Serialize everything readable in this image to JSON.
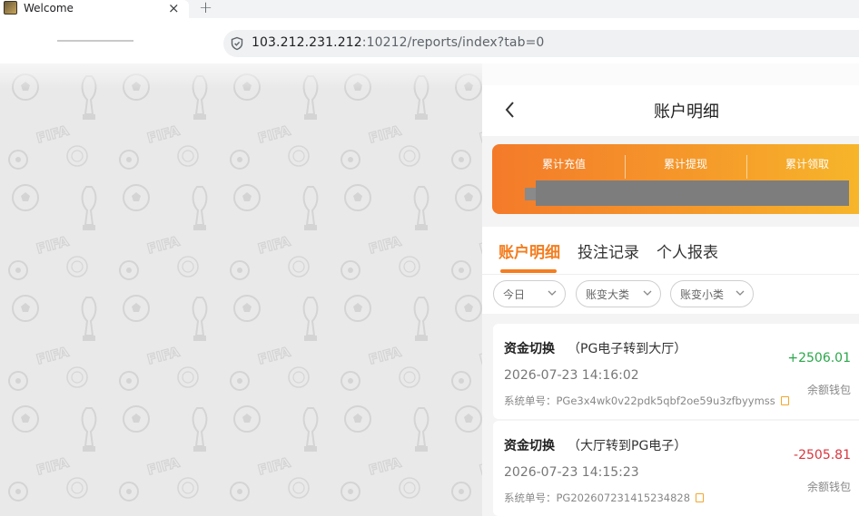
{
  "browser": {
    "tab_title": "Welcome",
    "tab_close": "×",
    "new_tab": "+",
    "url_host": "103.212.231.212",
    "url_rest": ":10212/reports/index?tab=0"
  },
  "header": {
    "title": "账户明细"
  },
  "summary_card": {
    "labels": [
      "累计充值",
      "累计提现",
      "累计领取"
    ]
  },
  "tabs": [
    {
      "label": "账户明细",
      "active": true
    },
    {
      "label": "投注记录",
      "active": false
    },
    {
      "label": "个人报表",
      "active": false
    }
  ],
  "filters": [
    {
      "label": "今日"
    },
    {
      "label": "账变大类"
    },
    {
      "label": "账变小类"
    }
  ],
  "records": [
    {
      "type": "资金切换",
      "desc": "（PG电子转到大厅）",
      "time": "2026-07-23 14:16:02",
      "order": "系统单号：PGe3x4wk0v22pdk5qbf2oe59u3zfbyymss",
      "amount": "+2506.01",
      "wallet": "余额钱包"
    },
    {
      "type": "资金切换",
      "desc": "（大厅转到PG电子）",
      "time": "2026-07-23 14:15:23",
      "order": "系统单号：PG202607231415234828",
      "amount": "-2505.81",
      "wallet": "余额钱包"
    }
  ],
  "colors": {
    "accent": "#f47d1f",
    "positive": "#2aa74a",
    "negative": "#d9363e"
  }
}
